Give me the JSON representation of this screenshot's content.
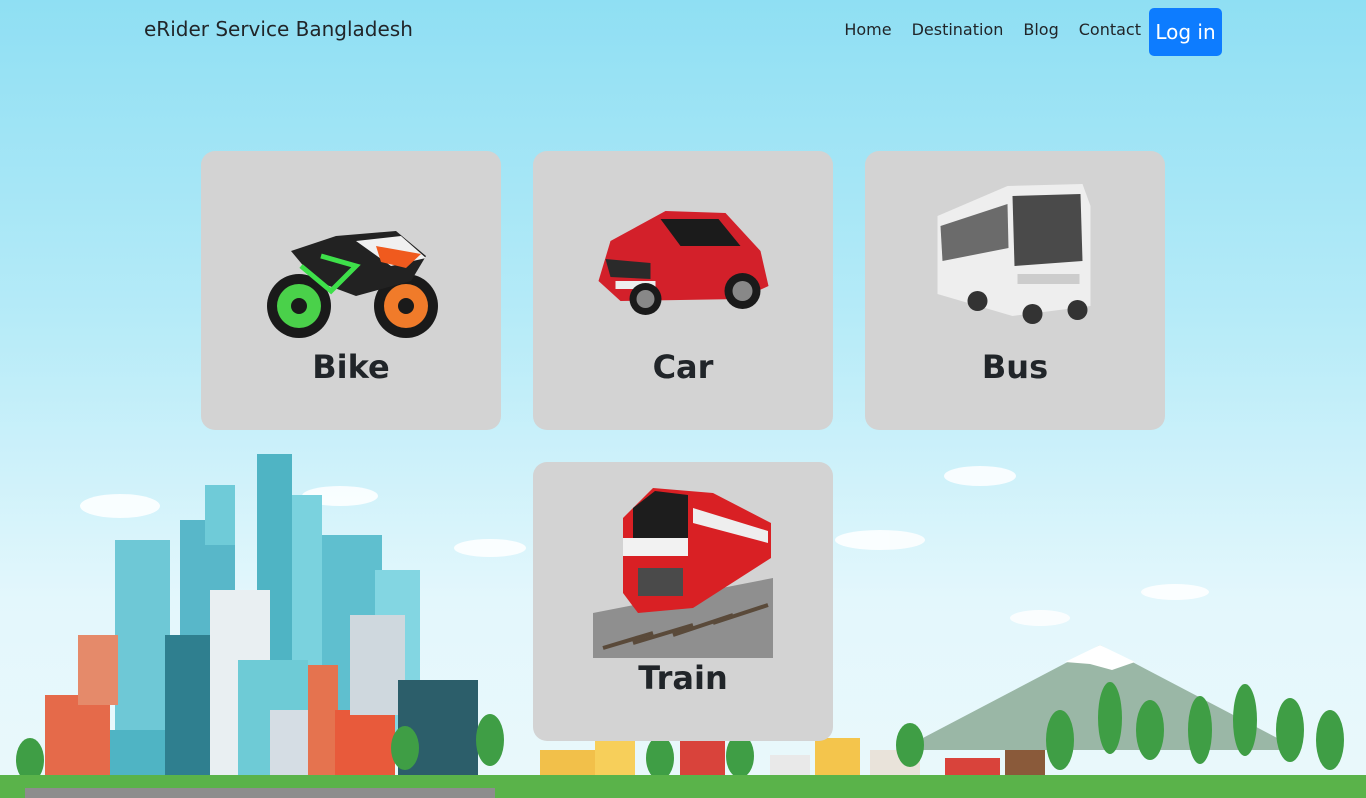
{
  "navbar": {
    "brand": "eRider Service Bangladesh",
    "links": [
      "Home",
      "Destination",
      "Blog",
      "Contact"
    ],
    "login_label": "Log in"
  },
  "vehicles": [
    {
      "label": "Bike",
      "icon": "motorbike-icon"
    },
    {
      "label": "Car",
      "icon": "car-icon"
    },
    {
      "label": "Bus",
      "icon": "bus-icon"
    },
    {
      "label": "Train",
      "icon": "train-icon"
    }
  ],
  "colors": {
    "accent": "#0d7cff",
    "card": "#d3d3d3",
    "sky_top": "#8fdff3"
  }
}
